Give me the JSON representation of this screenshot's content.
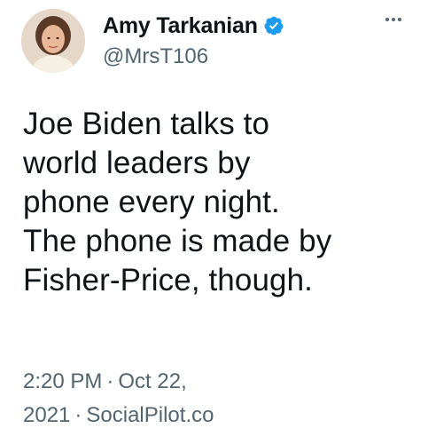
{
  "author": {
    "display_name": "Amy Tarkanian",
    "handle": "@MrsT106",
    "verified": true,
    "avatar_icon": "profile-photo"
  },
  "menu": {
    "more_icon": "more-horizontal-icon"
  },
  "tweet": {
    "lines": [
      "Joe Biden talks to",
      "world leaders by",
      "phone every night.",
      "The phone is made by",
      "Fisher-Price, though."
    ]
  },
  "meta": {
    "time": "2:20 PM",
    "date_part1": "Oct 22,",
    "date_part2": "2021",
    "separator": "·",
    "source": "SocialPilot.co"
  },
  "colors": {
    "text": "#0f1419",
    "secondary": "#536471",
    "verified": "#1d9bf0"
  }
}
